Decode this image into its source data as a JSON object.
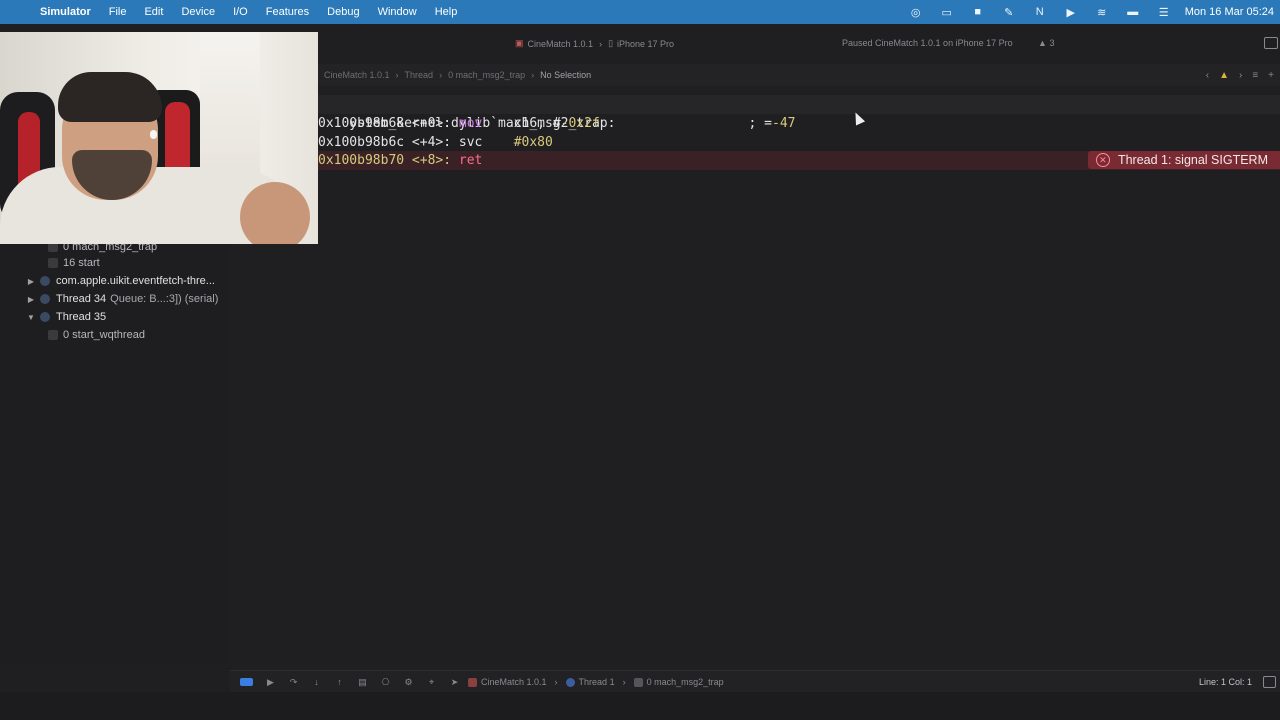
{
  "menubar": {
    "apple_glyph": "",
    "items": [
      "Simulator",
      "File",
      "Edit",
      "Device",
      "I/O",
      "Features",
      "Debug",
      "Window",
      "Help"
    ],
    "status_icons": [
      "screen-record-icon",
      "display-icon",
      "camera-icon",
      "pen-icon",
      "notion-icon",
      "play-icon",
      "wifi-icon",
      "battery-icon",
      "control-center-icon"
    ],
    "clock": "Mon 16 Mar  05:24"
  },
  "toolbar": {
    "scheme": "CineMatch 1.0.1",
    "destination": "iPhone 17 Pro",
    "status": "Paused CineMatch 1.0.1 on iPhone 17 Pro",
    "warnings": "3"
  },
  "jumpbar": {
    "crumbs": [
      "CineMatch 1.0.1",
      "Thread",
      "0 mach_msg2_trap"
    ],
    "selection": "No Selection"
  },
  "navigator": {
    "rows": [
      {
        "type": "frame",
        "label": "0 mach_msg2_trap"
      },
      {
        "type": "frame",
        "label": "16 start"
      },
      {
        "type": "thread",
        "expanded": false,
        "label": "com.apple.uikit.eventfetch-thre...",
        "sub": ""
      },
      {
        "type": "thread",
        "expanded": false,
        "label": "Thread 34",
        "sub": "Queue: B...:3]) (serial)"
      },
      {
        "type": "thread",
        "expanded": true,
        "label": "Thread 35",
        "sub": ""
      },
      {
        "type": "frame",
        "label": "0 start_wqthread"
      }
    ]
  },
  "editor": {
    "header": "ystem_kernel.dylib`mach_msg2_trap:",
    "lines": [
      {
        "addr": "0x100b98b68",
        "offset": "<+0>:",
        "op": "mov",
        "args_plain": "x16, #",
        "args_num": "-0x2f",
        "comment_prefix": "; =",
        "comment_num": "-47"
      },
      {
        "addr": "0x100b98b6c",
        "offset": "<+4>:",
        "op": "svc",
        "args_plain": "",
        "args_num": "#0x80",
        "comment_prefix": "",
        "comment_num": ""
      },
      {
        "addr": "0x100b98b70",
        "offset": "<+8>:",
        "op": "ret",
        "args_plain": "",
        "args_num": "",
        "comment_prefix": "",
        "comment_num": ""
      }
    ],
    "error_badge": "Thread 1: signal SIGTERM"
  },
  "debugbar": {
    "crumbs": [
      "CineMatch 1.0.1",
      "Thread 1",
      "0 mach_msg2_trap"
    ],
    "line_col": "Line: 1  Col: 1"
  },
  "colors": {
    "menubar_bg": "#2b79b8",
    "error_badge_bg": "#7a2a33",
    "keyword": "#c678dd",
    "number": "#d9c97c"
  }
}
